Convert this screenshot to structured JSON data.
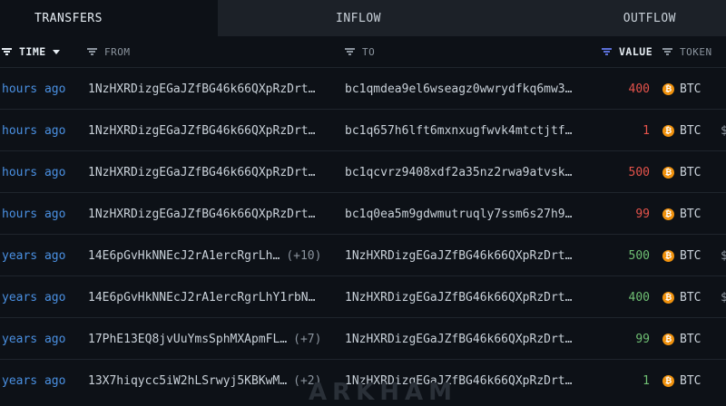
{
  "tabs": {
    "transfers": "TRANSFERS",
    "inflow": "INFLOW",
    "outflow": "OUTFLOW"
  },
  "columns": {
    "time": "TIME",
    "from": "FROM",
    "to": "TO",
    "value": "VALUE",
    "token": "TOKEN"
  },
  "colors": {
    "positive": "#6fbf73",
    "negative": "#e5534b",
    "accent": "#5b6fd8",
    "btc": "#f0920e"
  },
  "rows": [
    {
      "time": "hours ago",
      "from": "1NzHXRDizgEGaJZfBG46k66QXpRzDrt…",
      "from_extra": "",
      "to": "bc1qmdea9el6wseagz0wwrydfkq6mw3…",
      "value": "400",
      "dir": "out",
      "token": "BTC",
      "usd": ""
    },
    {
      "time": "hours ago",
      "from": "1NzHXRDizgEGaJZfBG46k66QXpRzDrt…",
      "from_extra": "",
      "to": "bc1q657h6lft6mxnxugfwvk4mtctjtf…",
      "value": "1",
      "dir": "out",
      "token": "BTC",
      "usd": "$"
    },
    {
      "time": "hours ago",
      "from": "1NzHXRDizgEGaJZfBG46k66QXpRzDrt…",
      "from_extra": "",
      "to": "bc1qcvrz9408xdf2a35nz2rwa9atvsk…",
      "value": "500",
      "dir": "out",
      "token": "BTC",
      "usd": ""
    },
    {
      "time": "hours ago",
      "from": "1NzHXRDizgEGaJZfBG46k66QXpRzDrt…",
      "from_extra": "",
      "to": "bc1q0ea5m9gdwmutruqly7ssm6s27h9…",
      "value": "99",
      "dir": "out",
      "token": "BTC",
      "usd": ""
    },
    {
      "time": "years ago",
      "from": "14E6pGvHkNNEcJ2rA1ercRgrLh…",
      "from_extra": "(+10)",
      "to": "1NzHXRDizgEGaJZfBG46k66QXpRzDrt…",
      "value": "500",
      "dir": "in",
      "token": "BTC",
      "usd": "$"
    },
    {
      "time": "years ago",
      "from": "14E6pGvHkNNEcJ2rA1ercRgrLhY1rbN…",
      "from_extra": "",
      "to": "1NzHXRDizgEGaJZfBG46k66QXpRzDrt…",
      "value": "400",
      "dir": "in",
      "token": "BTC",
      "usd": "$"
    },
    {
      "time": "years ago",
      "from": "17PhE13EQ8jvUuYmsSphMXApmFL…",
      "from_extra": "(+7)",
      "to": "1NzHXRDizgEGaJZfBG46k66QXpRzDrt…",
      "value": "99",
      "dir": "in",
      "token": "BTC",
      "usd": ""
    },
    {
      "time": "years ago",
      "from": "13X7hiqycc5iW2hLSrwyj5KBKwM…",
      "from_extra": "(+2)",
      "to": "1NzHXRDizgEGaJZfBG46k66QXpRzDrt…",
      "value": "1",
      "dir": "in",
      "token": "BTC",
      "usd": ""
    }
  ],
  "watermark": "ARKHAM"
}
